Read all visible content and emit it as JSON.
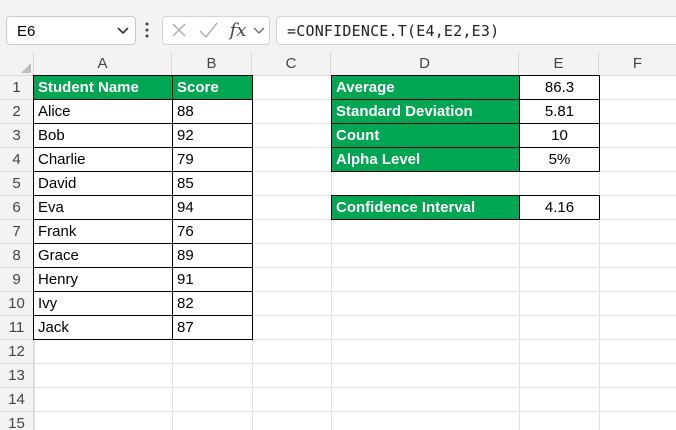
{
  "name_box": {
    "value": "E6"
  },
  "formula_bar": {
    "formula": "=CONFIDENCE.T(E4,E2,E3)",
    "fx_label": "fx"
  },
  "columns": [
    "A",
    "B",
    "C",
    "D",
    "E",
    "F"
  ],
  "rows": [
    "1",
    "2",
    "3",
    "4",
    "5",
    "6",
    "7",
    "8",
    "9",
    "10",
    "11",
    "12",
    "13",
    "14",
    "15"
  ],
  "table": {
    "headers": [
      "Student Name",
      "Score"
    ],
    "rows": [
      {
        "name": "Alice",
        "score": "88"
      },
      {
        "name": "Bob",
        "score": "92"
      },
      {
        "name": "Charlie",
        "score": "79"
      },
      {
        "name": "David",
        "score": "85"
      },
      {
        "name": "Eva",
        "score": "94"
      },
      {
        "name": "Frank",
        "score": "76"
      },
      {
        "name": "Grace",
        "score": "89"
      },
      {
        "name": "Henry",
        "score": "91"
      },
      {
        "name": "Ivy",
        "score": "82"
      },
      {
        "name": "Jack",
        "score": "87"
      }
    ]
  },
  "stats": [
    {
      "label": "Average",
      "value": "86.3"
    },
    {
      "label": "Standard Deviation",
      "value": "5.81"
    },
    {
      "label": "Count",
      "value": "10"
    },
    {
      "label": "Alpha Level",
      "value": "5%"
    }
  ],
  "result": {
    "label": "Confidence Interval",
    "value": "4.16"
  },
  "colors": {
    "header_fill": "#00a651",
    "header_text": "#ffffff",
    "grid": "#e1e1e1"
  }
}
